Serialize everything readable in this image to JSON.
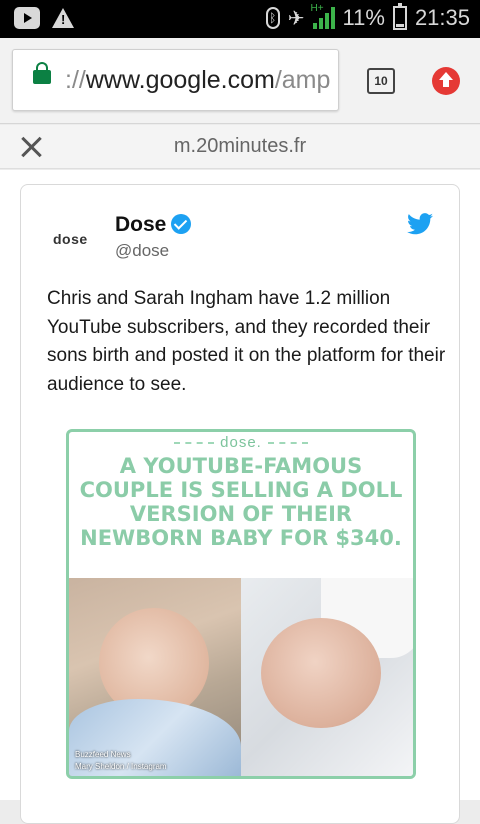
{
  "status_bar": {
    "battery": "11%",
    "time": "21:35",
    "network": "H+",
    "icons": [
      "youtube-icon",
      "warning-icon",
      "bluetooth-icon",
      "mute-icon",
      "signal-icon",
      "battery-icon"
    ]
  },
  "browser": {
    "url_scheme": "://",
    "url_host": "www.google.com",
    "url_rest": "/amp",
    "tab_count": "10",
    "accent_lock": "#0b8043",
    "accent_update": "#e53935"
  },
  "amp_header": {
    "domain": "m.20minutes.fr"
  },
  "tweet": {
    "avatar_text": "dose",
    "name": "Dose",
    "handle": "@dose",
    "text": "Chris and Sarah Ingham have 1.2 million YouTube subscribers, and they recorded their sons birth and posted it on the platform for their audience to see.",
    "verified_color": "#1da1f2",
    "twitter_color": "#1da1f2"
  },
  "media": {
    "logo": "dose.",
    "headline": "A YouTube-famous couple is selling a doll version of their newborn baby for $340.",
    "credit_1": "Buzzfeed News",
    "credit_2": "Mary Sheldon / Instagram",
    "accent": "#8bcca8"
  }
}
